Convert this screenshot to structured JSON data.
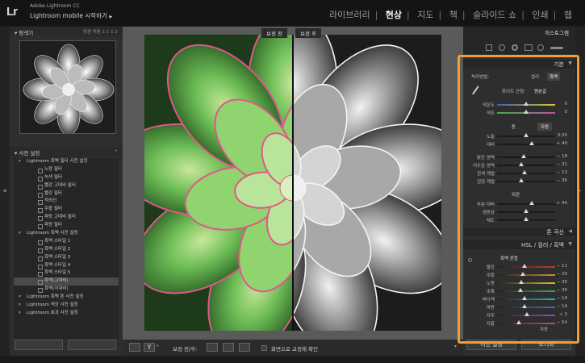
{
  "app": {
    "logo": "Lr",
    "brand_line1": "Adobe Lightroom CC",
    "brand_line2": "Lightroom mobile 시작하기",
    "brand_arrow": "▶"
  },
  "modules": [
    "라이브러리",
    "현상",
    "지도",
    "책",
    "슬라이드 쇼",
    "인쇄",
    "웹"
  ],
  "left": {
    "navigator": {
      "title": "탐색기",
      "zoom_options": "맞춤 채움 1:1 1:2"
    },
    "presets": {
      "title": "사전 설정",
      "add_icon": "+",
      "items": [
        {
          "label": "Lightroom 흑백 필터 사전 설정",
          "kind": "group"
        },
        {
          "label": "노랑 필터",
          "kind": "child"
        },
        {
          "label": "녹색 필터",
          "kind": "child"
        },
        {
          "label": "빨강 고대비 필터",
          "kind": "child"
        },
        {
          "label": "빨강 필터",
          "kind": "child"
        },
        {
          "label": "적외선",
          "kind": "child"
        },
        {
          "label": "주황 필터",
          "kind": "child"
        },
        {
          "label": "파랑 고대비 필터",
          "kind": "child"
        },
        {
          "label": "파랑 필터",
          "kind": "child"
        },
        {
          "label": "Lightroom 흑백 사전 설정",
          "kind": "group"
        },
        {
          "label": "흑백 스타일 1",
          "kind": "child"
        },
        {
          "label": "흑백 스타일 2",
          "kind": "child"
        },
        {
          "label": "흑백 스타일 3",
          "kind": "child"
        },
        {
          "label": "흑백 스타일 4",
          "kind": "child"
        },
        {
          "label": "흑백 스타일 5",
          "kind": "child"
        },
        {
          "label": "흑백(고대비)",
          "kind": "child",
          "selected": true
        },
        {
          "label": "흑백(저대비)",
          "kind": "child"
        },
        {
          "label": "Lightroom 흑백 톤 사전 설정",
          "kind": "group"
        },
        {
          "label": "Lightroom 색상 사전 설정",
          "kind": "group"
        },
        {
          "label": "Lightroom 효과 사전 설정",
          "kind": "group"
        }
      ]
    }
  },
  "center": {
    "before_label": "보정 전",
    "after_label": "보정 후",
    "toolbar": {
      "compare_label": "보정 전/후:",
      "soft_proof_label": "화면으로 교정해 확인"
    }
  },
  "right": {
    "histogram_title": "히스토그램",
    "basic": {
      "title": "기본",
      "treatment_label": "처리방법:",
      "treatment_color": "컬러",
      "treatment_bw": "흑백",
      "wb_label": "화이트 균형:",
      "wb_value": "원본값",
      "temp": {
        "label": "색온도",
        "value": "0",
        "pos": 0.5
      },
      "tint": {
        "label": "색조",
        "value": "0",
        "pos": 0.5
      },
      "tone_label": "톤",
      "auto_label": "자동",
      "exposure": {
        "label": "노출",
        "value": "0.00",
        "pos": 0.5
      },
      "contrast": {
        "label": "대비",
        "value": "+ 40",
        "pos": 0.6
      },
      "highlights": {
        "label": "밝은 영역",
        "value": "− 18",
        "pos": 0.46
      },
      "shadows": {
        "label": "어두운 영역",
        "value": "− 31",
        "pos": 0.42
      },
      "whites": {
        "label": "흰색 계열",
        "value": "− 13",
        "pos": 0.47
      },
      "blacks": {
        "label": "검정 계열",
        "value": "− 36",
        "pos": 0.41
      },
      "presence_label": "외관",
      "clarity": {
        "label": "부분 대비",
        "value": "+ 40",
        "pos": 0.6
      },
      "vibrance": {
        "label": "생동감",
        "value": "",
        "pos": 0.5
      },
      "saturation": {
        "label": "채도",
        "value": "",
        "pos": 0.5
      }
    },
    "tone_curve_title": "톤 곡선",
    "hsl": {
      "title": "HSL / 컬러 / 흑백",
      "mix_label": "흑백 혼합",
      "sliders": [
        {
          "label": "빨강",
          "value": "− 11",
          "pos": 0.47,
          "color": "#c0392b"
        },
        {
          "label": "주황",
          "value": "− 20",
          "pos": 0.45,
          "color": "#d68a2b"
        },
        {
          "label": "노랑",
          "value": "− 35",
          "pos": 0.41,
          "color": "#d8c32a"
        },
        {
          "label": "초록",
          "value": "− 39",
          "pos": 0.4,
          "color": "#3fae3f"
        },
        {
          "label": "바다색",
          "value": "− 14",
          "pos": 0.47,
          "color": "#2ab3b3"
        },
        {
          "label": "파랑",
          "value": "− 14",
          "pos": 0.47,
          "color": "#3a6fd8"
        },
        {
          "label": "자주",
          "value": "+ 3",
          "pos": 0.51,
          "color": "#8a4fd0"
        },
        {
          "label": "자홍",
          "value": "− 54",
          "pos": 0.37,
          "color": "#d03f9e"
        }
      ],
      "auto_label": "자동"
    },
    "prev_button": "이전 설정",
    "reset_button": "초기화"
  },
  "accent_color": "#f39c37"
}
